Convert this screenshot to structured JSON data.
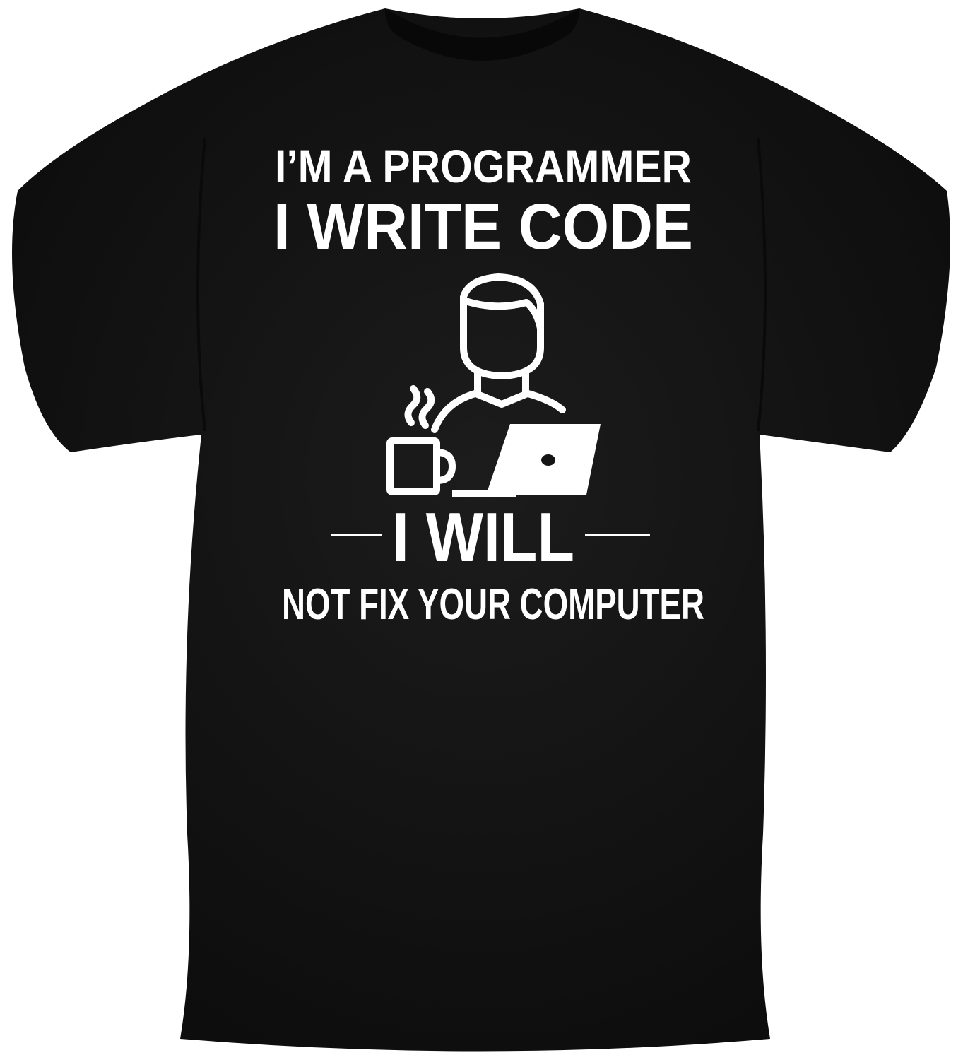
{
  "print": {
    "line1": "I’M A PROGRAMMER",
    "line2": "I WRITE CODE",
    "line3": "I WILL",
    "line4": "NOT FIX YOUR COMPUTER"
  },
  "colors": {
    "shirt": "#141414",
    "print": "#ffffff",
    "background": "#ffffff"
  },
  "icons": [
    "programmer-icon",
    "coffee-mug-icon",
    "laptop-icon"
  ]
}
